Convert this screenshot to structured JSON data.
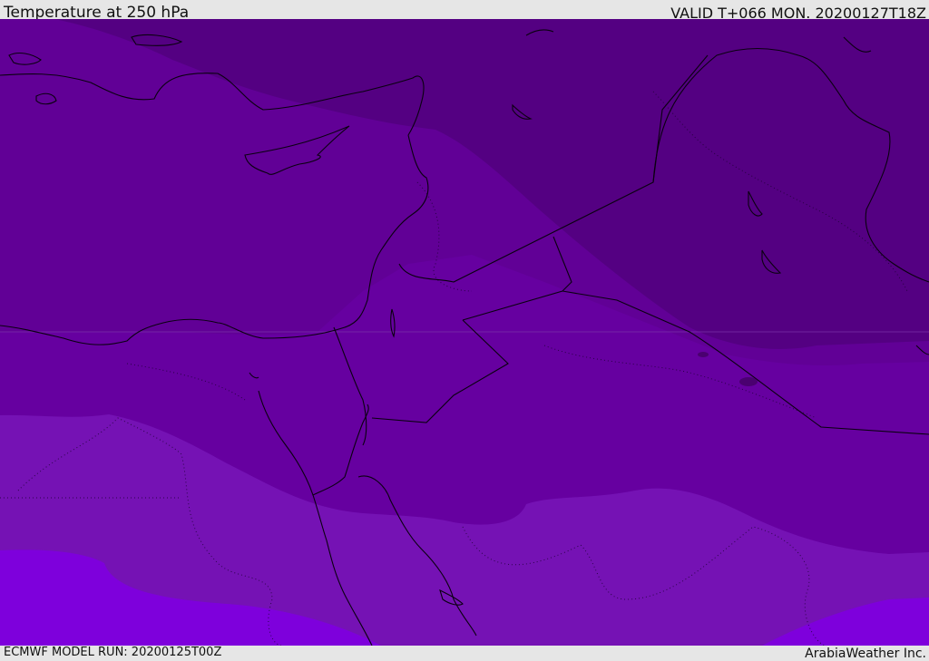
{
  "header": {
    "title": "Temperature at 250 hPa",
    "valid": "VALID T+066 MON. 20200127T18Z"
  },
  "footer": {
    "model_run": "ECMWF MODEL RUN: 20200125T00Z",
    "credit": "ArabiaWeather Inc."
  },
  "map": {
    "colors": {
      "band_darkest": "#540082",
      "band_dark": "#610096",
      "band_mid": "#6600a0",
      "band_light": "#7512b4",
      "band_lightest": "#7e00dc",
      "coastline": "#0a0010"
    }
  }
}
